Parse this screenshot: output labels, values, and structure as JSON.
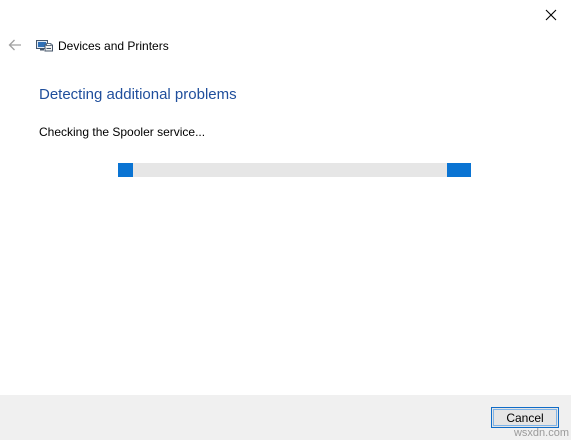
{
  "window": {
    "title": "Devices and Printers",
    "icon": "devices-printers-icon"
  },
  "wizard": {
    "heading": "Detecting additional problems",
    "status": "Checking the Spooler service...",
    "progress": {
      "mode": "indeterminate",
      "color": "#0a74d3",
      "track_color": "#e6e6e6"
    }
  },
  "footer": {
    "cancel_label": "Cancel"
  },
  "watermark": "wsxdn.com",
  "colors": {
    "heading": "#1f4e9c",
    "accent": "#0a74d3",
    "footer_bg": "#f0f0f0"
  }
}
